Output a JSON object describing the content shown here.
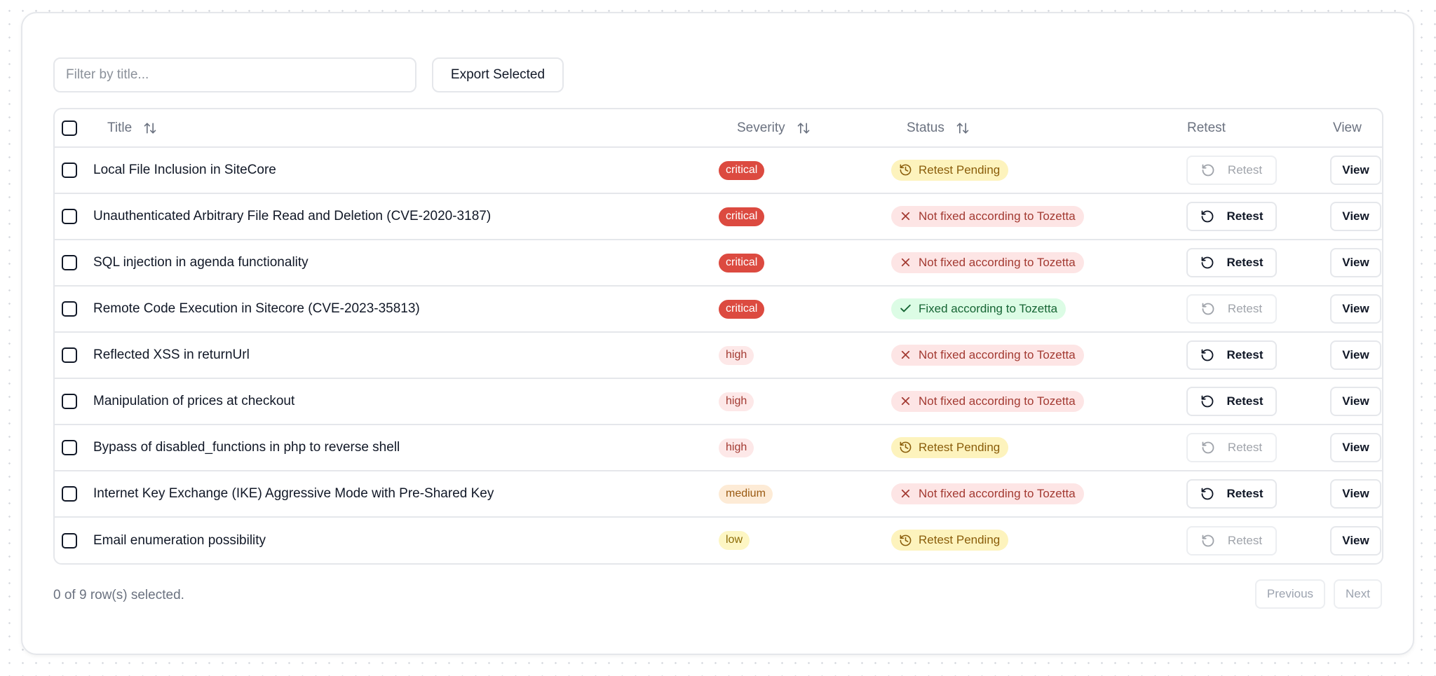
{
  "toolbar": {
    "filter_placeholder": "Filter by title...",
    "filter_value": "",
    "export_label": "Export Selected"
  },
  "table": {
    "headers": {
      "title": "Title",
      "severity": "Severity",
      "status": "Status",
      "retest": "Retest",
      "view": "View"
    },
    "retest_label": "Retest",
    "view_label": "View",
    "rows": [
      {
        "title": "Local File Inclusion in SiteCore",
        "severity": "critical",
        "status": "Retest Pending",
        "status_type": "pending",
        "retest_enabled": false
      },
      {
        "title": "Unauthenticated Arbitrary File Read and Deletion (CVE-2020-3187)",
        "severity": "critical",
        "status": "Not fixed according to Tozetta",
        "status_type": "notfixed",
        "retest_enabled": true
      },
      {
        "title": "SQL injection in agenda functionality",
        "severity": "critical",
        "status": "Not fixed according to Tozetta",
        "status_type": "notfixed",
        "retest_enabled": true
      },
      {
        "title": "Remote Code Execution in Sitecore (CVE-2023-35813)",
        "severity": "critical",
        "status": "Fixed according to Tozetta",
        "status_type": "fixed",
        "retest_enabled": false
      },
      {
        "title": "Reflected XSS in returnUrl",
        "severity": "high",
        "status": "Not fixed according to Tozetta",
        "status_type": "notfixed",
        "retest_enabled": true
      },
      {
        "title": "Manipulation of prices at checkout",
        "severity": "high",
        "status": "Not fixed according to Tozetta",
        "status_type": "notfixed",
        "retest_enabled": true
      },
      {
        "title": "Bypass of disabled_functions in php to reverse shell",
        "severity": "high",
        "status": "Retest Pending",
        "status_type": "pending",
        "retest_enabled": false
      },
      {
        "title": "Internet Key Exchange (IKE) Aggressive Mode with Pre-Shared Key",
        "severity": "medium",
        "status": "Not fixed according to Tozetta",
        "status_type": "notfixed",
        "retest_enabled": true
      },
      {
        "title": "Email enumeration possibility",
        "severity": "low",
        "status": "Retest Pending",
        "status_type": "pending",
        "retest_enabled": false
      }
    ]
  },
  "footer": {
    "selection_text": "0 of 9 row(s) selected.",
    "previous_label": "Previous",
    "next_label": "Next"
  },
  "icons": {
    "sort": "arrow-up-down-icon",
    "pending": "history-clock-icon",
    "notfixed": "x-icon",
    "fixed": "check-icon",
    "retest": "rotate-ccw-icon"
  }
}
